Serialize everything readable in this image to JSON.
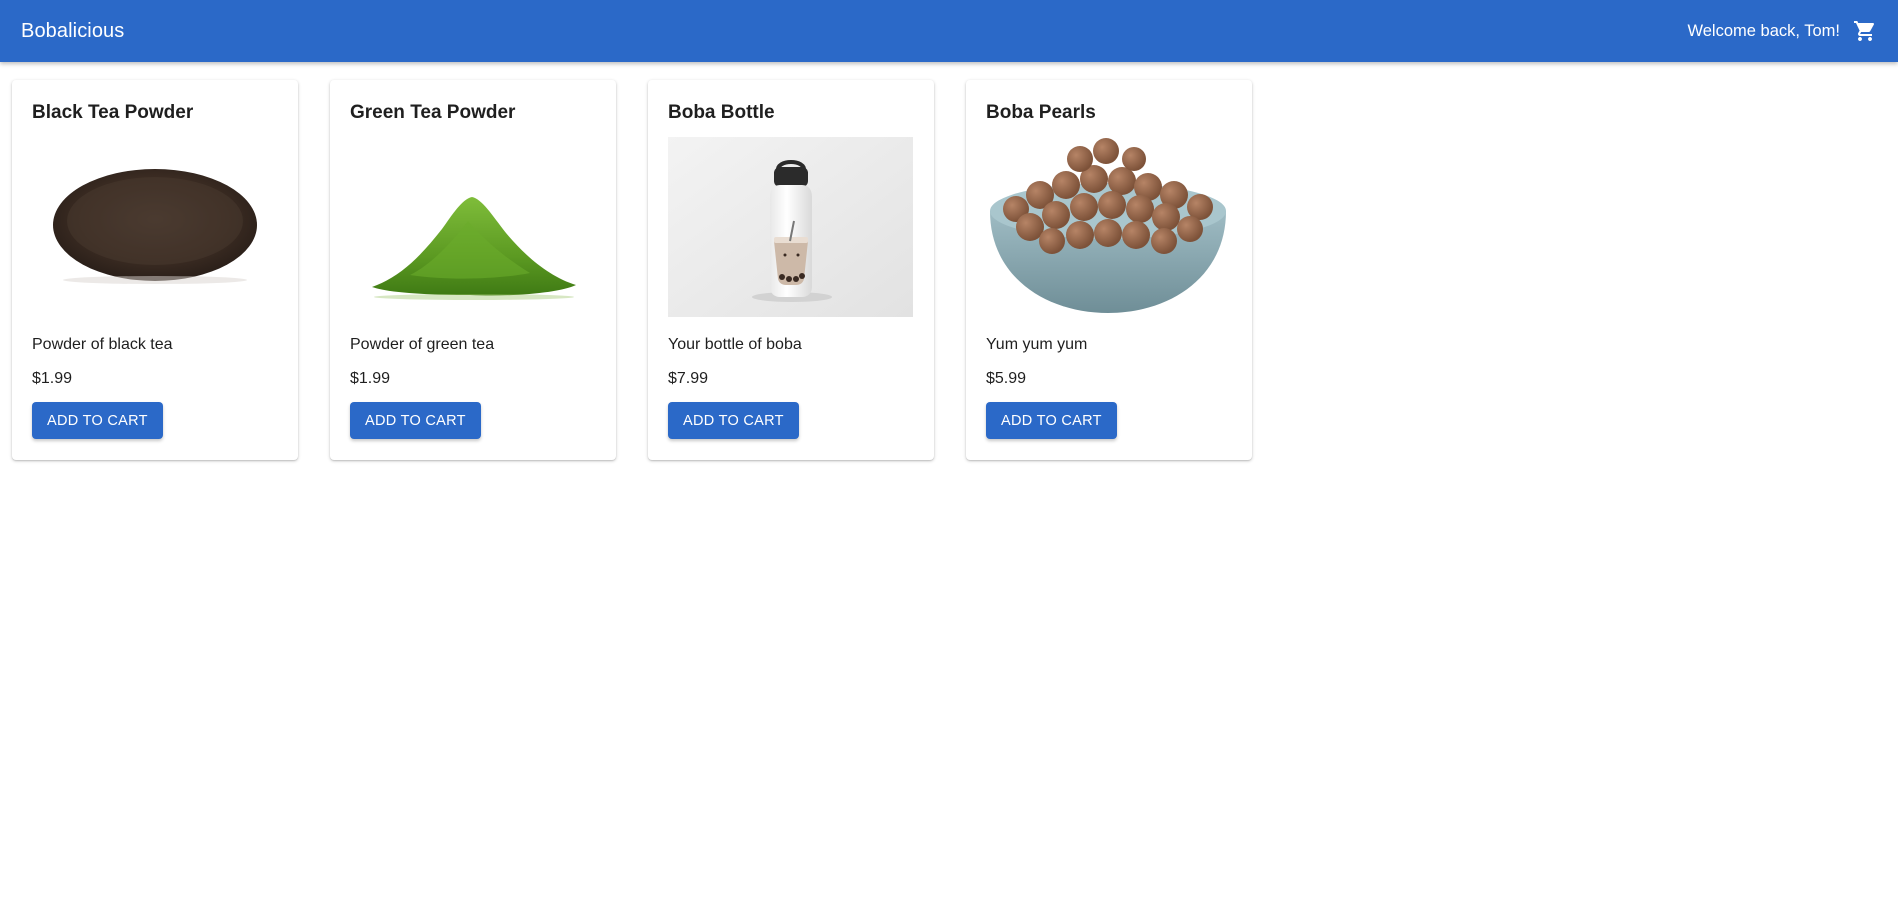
{
  "header": {
    "brand": "Bobalicious",
    "welcome": "Welcome back, Tom!",
    "cart_icon": "shopping-cart-icon"
  },
  "colors": {
    "primary": "#2b69c8",
    "on_primary": "#ffffff",
    "text": "#1f1f1f"
  },
  "products": [
    {
      "title": "Black Tea Powder",
      "image": "black-tea-powder-image",
      "description": "Powder of black tea",
      "price": "$1.99",
      "button": "ADD TO CART"
    },
    {
      "title": "Green Tea Powder",
      "image": "green-tea-powder-image",
      "description": "Powder of green tea",
      "price": "$1.99",
      "button": "ADD TO CART"
    },
    {
      "title": "Boba Bottle",
      "image": "boba-bottle-image",
      "description": "Your bottle of boba",
      "price": "$7.99",
      "button": "ADD TO CART"
    },
    {
      "title": "Boba Pearls",
      "image": "boba-pearls-image",
      "description": "Yum yum yum",
      "price": "$5.99",
      "button": "ADD TO CART"
    }
  ]
}
